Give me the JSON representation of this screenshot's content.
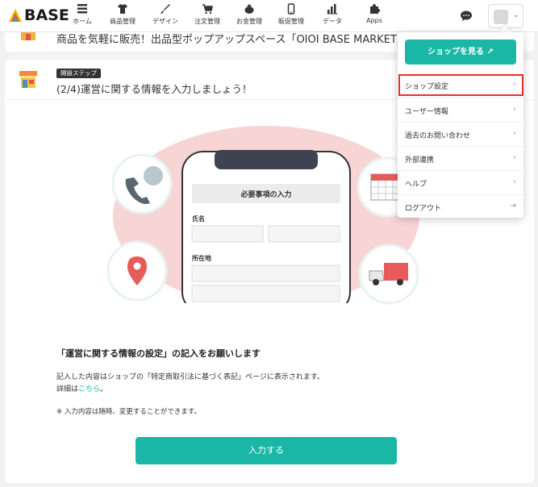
{
  "header": {
    "logo": "BASE",
    "nav": [
      {
        "label": "ホーム",
        "icon": "home-icon"
      },
      {
        "label": "商品管理",
        "icon": "tshirt-icon"
      },
      {
        "label": "デザイン",
        "icon": "brush-icon"
      },
      {
        "label": "注文管理",
        "icon": "cart-icon"
      },
      {
        "label": "お金管理",
        "icon": "wallet-icon"
      },
      {
        "label": "販促管理",
        "icon": "phone-icon"
      },
      {
        "label": "データ",
        "icon": "bar-chart-icon"
      },
      {
        "label": "Apps",
        "icon": "puzzle-icon"
      }
    ],
    "chat_icon": "chat-icon",
    "shop_chevron": "⌄"
  },
  "banner": {
    "text": "商品を気軽に販売！出品型ポップアップスペース「OIOI BASE MARKET」のご案内"
  },
  "step_card": {
    "badge": "開設ステップ",
    "title": "(2/4)運営に関する情報を入力しましょう！",
    "illustration": {
      "header": "必要事項の入力",
      "name_label": "氏名",
      "address_label": "所在地"
    },
    "heading": "「運営に関する情報の設定」の記入をお願いします",
    "body_line1": "記入した内容はショップの「特定商取引法に基づく表記」ページに表示されます。",
    "body_line2_prefix": "詳細は",
    "body_link": "こちら",
    "body_line2_suffix": "。",
    "note": "※ 入力内容は随時、変更することができます。",
    "submit_label": "入力する"
  },
  "dropdown": {
    "view_shop_label": "ショップを見る ↗",
    "items": [
      {
        "label": "ショップ設定",
        "arrow": "›"
      },
      {
        "label": "ユーザー情報",
        "arrow": "›"
      },
      {
        "label": "過去のお問い合わせ",
        "arrow": "›"
      },
      {
        "label": "外部連携",
        "arrow": "›"
      },
      {
        "label": "ヘルプ",
        "arrow": "›"
      },
      {
        "label": "ログアウト",
        "arrow": "⇥"
      }
    ]
  },
  "colors": {
    "accent": "#1bb7a6",
    "highlight": "#e8302a",
    "illustration_blob": "#f8d5d5"
  }
}
